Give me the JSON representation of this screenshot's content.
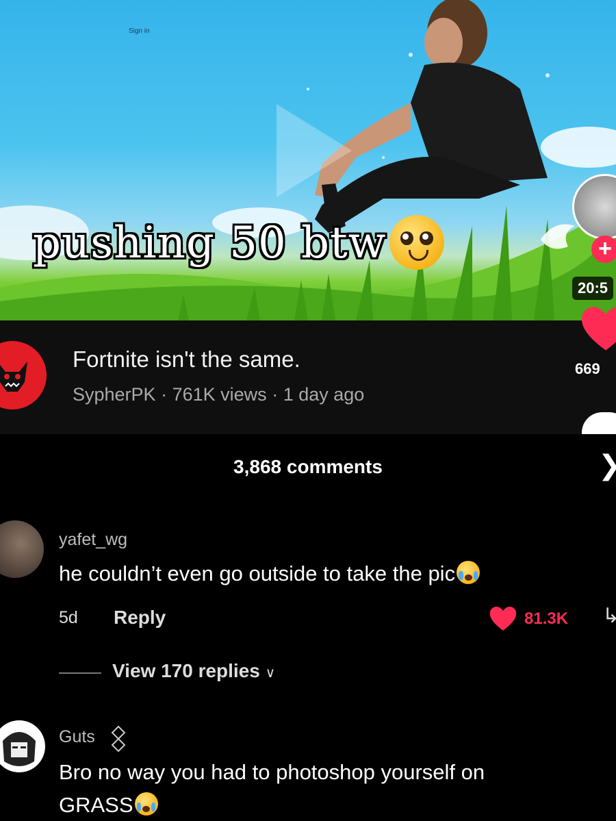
{
  "thumbnail": {
    "overlay_text": "pushing 50 btw",
    "overlay_emoji": "pleading-face",
    "duration": "20:5",
    "signin_text": "Sign in"
  },
  "video": {
    "title": "Fortnite isn't the same.",
    "channel": "SypherPK",
    "separator": "·",
    "views": "761K views",
    "age": "1 day ago",
    "like_count": "669"
  },
  "comments_panel": {
    "count_label": "3,868 comments",
    "close_icon": "chevron-right-icon",
    "comments": [
      {
        "username": "yafet_wg",
        "text": "he couldn’t even go outside to take the pic",
        "emoji": "loudly-crying-face",
        "time": "5d",
        "reply_label": "Reply",
        "likes": "81.3K",
        "view_replies": "View 170 replies"
      },
      {
        "username": "Guts",
        "text_line1": "Bro no way you had to photoshop yourself on",
        "text_line2": "GRASS",
        "emoji": "loudly-crying-face"
      }
    ]
  },
  "colors": {
    "accent_red": "#fe2c55",
    "sky": "#4cc3ef",
    "grass": "#4fb11e",
    "info_bg": "#0f0f0f"
  }
}
